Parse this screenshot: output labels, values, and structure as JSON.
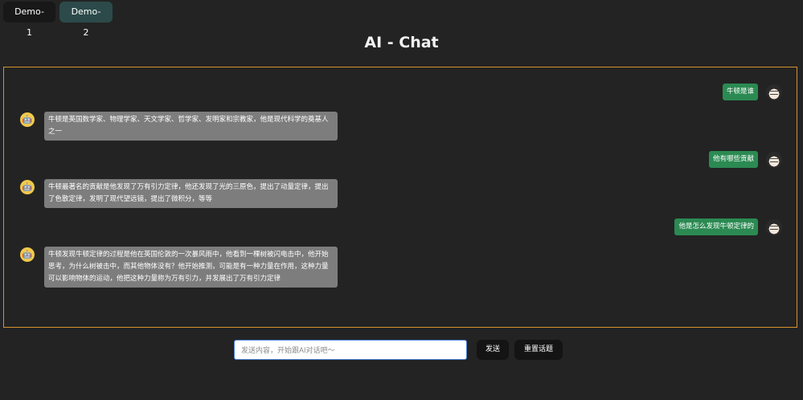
{
  "tabs": [
    {
      "label": "Demo-1",
      "active": false
    },
    {
      "label": "Demo-2",
      "active": true
    }
  ],
  "header": {
    "title": "AI - Chat"
  },
  "messages": [
    {
      "role": "user",
      "text": "牛顿是谁"
    },
    {
      "role": "ai",
      "text": "牛顿是英国数学家、物理学家、天文学家、哲学家、发明家和宗教家，他是现代科学的奠基人之一"
    },
    {
      "role": "user",
      "text": "他有哪些贡献"
    },
    {
      "role": "ai",
      "text": "牛顿最著名的贡献是他发现了万有引力定律，他还发现了光的三原色，提出了动量定律，提出了色散定律，发明了现代望远镜，提出了微积分，等等"
    },
    {
      "role": "user",
      "text": "他是怎么发现牛顿定律的"
    },
    {
      "role": "ai",
      "text": "牛顿发现牛顿定律的过程是他在英国伦敦的一次暴风雨中，他看到一棵树被闪电击中，他开始思考，为什么树被击中，而其他物体没有？他开始推测，可能是有一种力量在作用，这种力量可以影响物体的运动，他把这种力量称为万有引力，并发展出了万有引力定律"
    }
  ],
  "composer": {
    "placeholder": "发送内容，开始跟AI对话吧～",
    "value": "",
    "send_label": "发送",
    "reset_label": "重置话题"
  },
  "icons": {
    "ai_avatar": "robot-face-icon",
    "user_avatar": "user-avatar-icon"
  },
  "colors": {
    "background": "#232323",
    "border_accent": "#d6922c",
    "user_bubble": "#2b8a52",
    "ai_bubble": "#7d7d7d",
    "tab_active": "#2c4a4a",
    "input_focus": "#4a84d8"
  }
}
